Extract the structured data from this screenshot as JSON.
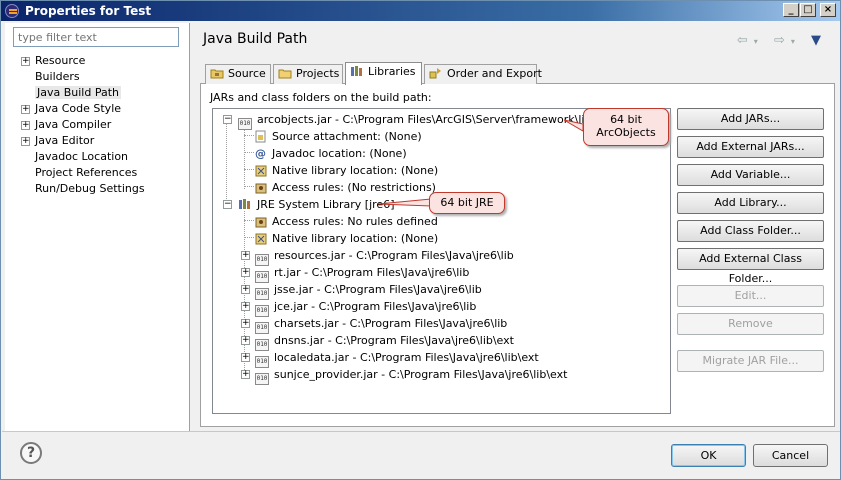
{
  "window": {
    "title": "Properties for Test"
  },
  "filter": {
    "placeholder": "type filter text"
  },
  "nav": {
    "items": [
      {
        "label": "Resource",
        "expandable": true
      },
      {
        "label": "Builders",
        "expandable": false
      },
      {
        "label": "Java Build Path",
        "expandable": false,
        "selected": true
      },
      {
        "label": "Java Code Style",
        "expandable": true
      },
      {
        "label": "Java Compiler",
        "expandable": true
      },
      {
        "label": "Java Editor",
        "expandable": true
      },
      {
        "label": "Javadoc Location",
        "expandable": false
      },
      {
        "label": "Project References",
        "expandable": false
      },
      {
        "label": "Run/Debug Settings",
        "expandable": false
      }
    ]
  },
  "page": {
    "title": "Java Build Path"
  },
  "tabs": [
    {
      "label": "Source"
    },
    {
      "label": "Projects"
    },
    {
      "label": "Libraries",
      "active": true
    },
    {
      "label": "Order and Export"
    }
  ],
  "libraries": {
    "header": "JARs and class folders on the build path:",
    "tree": {
      "arcobjects": "arcobjects.jar - C:\\Program Files\\ArcGIS\\Server\\framework\\lib",
      "arc_source": "Source attachment: (None)",
      "arc_javadoc": "Javadoc location: (None)",
      "arc_native": "Native library location: (None)",
      "arc_access": "Access rules: (No restrictions)",
      "jre": "JRE System Library [jre6]",
      "jre_access": "Access rules: No rules defined",
      "jre_native": "Native library location: (None)",
      "jars": [
        "resources.jar - C:\\Program Files\\Java\\jre6\\lib",
        "rt.jar - C:\\Program Files\\Java\\jre6\\lib",
        "jsse.jar - C:\\Program Files\\Java\\jre6\\lib",
        "jce.jar - C:\\Program Files\\Java\\jre6\\lib",
        "charsets.jar - C:\\Program Files\\Java\\jre6\\lib",
        "dnsns.jar - C:\\Program Files\\Java\\jre6\\lib\\ext",
        "localedata.jar - C:\\Program Files\\Java\\jre6\\lib\\ext",
        "sunjce_provider.jar - C:\\Program Files\\Java\\jre6\\lib\\ext"
      ]
    },
    "buttons": {
      "add_jars": "Add JARs...",
      "add_external_jars": "Add External JARs...",
      "add_variable": "Add Variable...",
      "add_library": "Add Library...",
      "add_class_folder": "Add Class Folder...",
      "add_external_class_folder": "Add External Class Folder...",
      "edit": "Edit...",
      "remove": "Remove",
      "migrate": "Migrate JAR File..."
    },
    "callouts": {
      "arcobjects_line1": "64 bit",
      "arcobjects_line2": "ArcObjects",
      "jre": "64 bit JRE"
    }
  },
  "dialog": {
    "ok": "OK",
    "cancel": "Cancel",
    "help_symbol": "?"
  },
  "colors": {
    "title_bar": "#0a246a",
    "callout_border": "#c0392b",
    "callout_fill": "#fbe3e1"
  }
}
